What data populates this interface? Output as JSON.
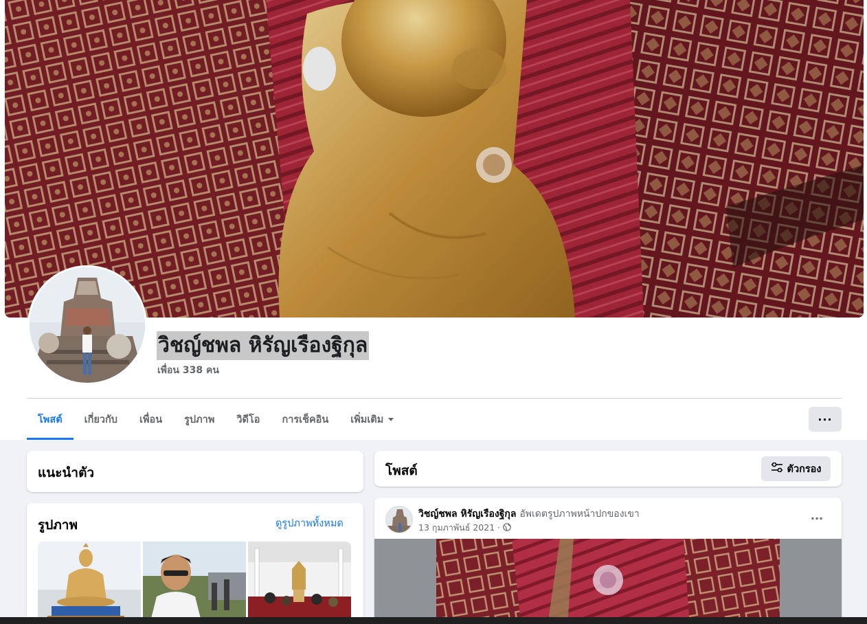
{
  "profile": {
    "name": "วิชญ์ชพล หิรัญเรืองฐิกุล",
    "friends": "เพื่อน 338 คน"
  },
  "tabs": [
    {
      "label": "โพสต์",
      "active": true
    },
    {
      "label": "เกี่ยวกับ"
    },
    {
      "label": "เพื่อน"
    },
    {
      "label": "รูปภาพ"
    },
    {
      "label": "วิดีโอ"
    },
    {
      "label": "การเช็คอิน"
    },
    {
      "label": "เพิ่มเติม"
    }
  ],
  "more_button": "···",
  "intro": {
    "title": "แนะนำตัว"
  },
  "photos": {
    "title": "รูปภาพ",
    "see_all": "ดูรูปภาพทั้งหมด"
  },
  "posts": {
    "title": "โพสต์",
    "filter_label": "ตัวกรอง"
  },
  "post": {
    "author": "วิชญ์ชพล หิรัญเรืองฐิกุล",
    "action": "อัพเดตรูปภาพหน้าปกของเขา",
    "date": "13 กุมภาพันธ์ 2021 ·",
    "more": "···"
  },
  "icons": {
    "caret": "chevron-down-icon",
    "filter": "sliders-icon",
    "audience": "globe-icon",
    "more": "ellipsis-icon"
  },
  "colors": {
    "accent": "#1877f2",
    "secondary_text": "#65676b",
    "button_bg": "#e4e6eb",
    "page_bg": "#f0f2f5"
  }
}
